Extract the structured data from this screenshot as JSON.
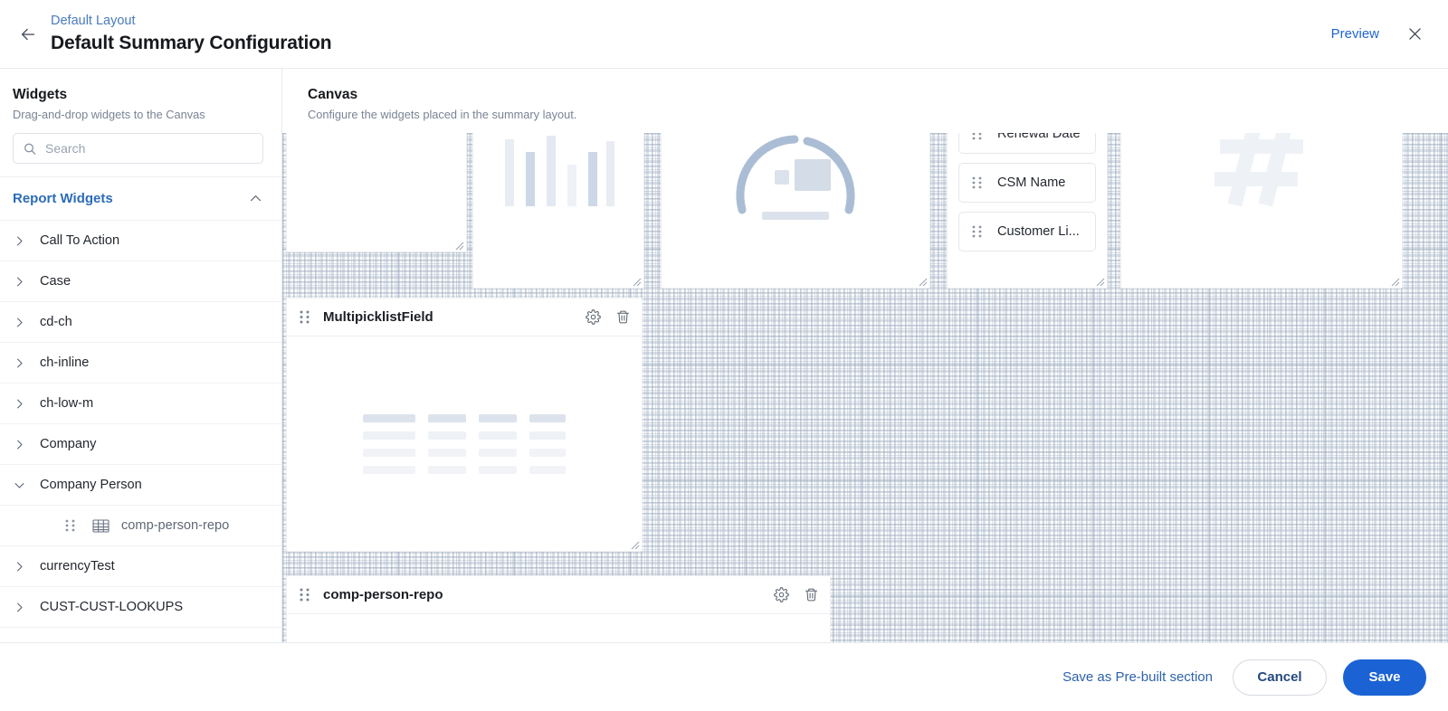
{
  "header": {
    "breadcrumb": "Default Layout",
    "title": "Default Summary Configuration",
    "preview_label": "Preview",
    "back_icon": "arrow-left-icon",
    "close_icon": "close-icon"
  },
  "sidebar": {
    "title": "Widgets",
    "subtitle": "Drag-and-drop widgets to the Canvas",
    "search": {
      "value": "",
      "placeholder": "Search",
      "icon": "search-icon"
    },
    "group": {
      "label": "Report Widgets",
      "expanded": true,
      "chevron": "chevron-up-icon"
    },
    "items": [
      {
        "label": "Call To Action",
        "type": "folder",
        "expanded": false
      },
      {
        "label": "Case",
        "type": "folder",
        "expanded": false
      },
      {
        "label": "cd-ch",
        "type": "folder",
        "expanded": false
      },
      {
        "label": "ch-inline",
        "type": "folder",
        "expanded": false
      },
      {
        "label": "ch-low-m",
        "type": "folder",
        "expanded": false
      },
      {
        "label": "Company",
        "type": "folder",
        "expanded": false
      },
      {
        "label": "Company Person",
        "type": "folder",
        "expanded": true
      },
      {
        "label": "comp-person-repo",
        "type": "leaf",
        "icon": "table-icon"
      },
      {
        "label": "currencyTest",
        "type": "folder",
        "expanded": false
      },
      {
        "label": "CUST-CUST-LOOKUPS",
        "type": "folder",
        "expanded": false
      }
    ]
  },
  "canvas": {
    "title": "Canvas",
    "subtitle": "Configure the widgets placed in the summary layout.",
    "widgets": [
      {
        "id": "w-blank-top",
        "name": "",
        "placeholder": "blank",
        "show_header": false
      },
      {
        "id": "w-bar",
        "name": "",
        "placeholder": "bar-chart",
        "show_header": false
      },
      {
        "id": "w-gauge",
        "name": "",
        "placeholder": "gauge-chart",
        "show_header": false
      },
      {
        "id": "w-fieldlist",
        "name": "",
        "placeholder": "field-list",
        "show_header": false,
        "fields": [
          "Renewal Date",
          "CSM Name",
          "Customer Li..."
        ]
      },
      {
        "id": "w-hash",
        "name": "",
        "placeholder": "hash-number",
        "show_header": false
      },
      {
        "id": "w-multipicklist",
        "name": "MultipicklistField",
        "placeholder": "table-skeleton",
        "show_header": true,
        "settings_icon": "gear-icon",
        "delete_icon": "trash-icon"
      },
      {
        "id": "w-compperson",
        "name": "comp-person-repo",
        "placeholder": "blank",
        "show_header": true,
        "settings_icon": "gear-icon",
        "delete_icon": "trash-icon"
      }
    ]
  },
  "footer": {
    "save_prebuilt_label": "Save as Pre-built section",
    "cancel_label": "Cancel",
    "save_label": "Save"
  },
  "colors": {
    "accent": "#1b63d4",
    "link": "#2d62ad",
    "breadcrumb": "#4a7bbd",
    "group_label": "#2b6cb8",
    "text": "#16191d",
    "muted": "#7a8494",
    "placeholder_blue": "#aabdd4"
  }
}
